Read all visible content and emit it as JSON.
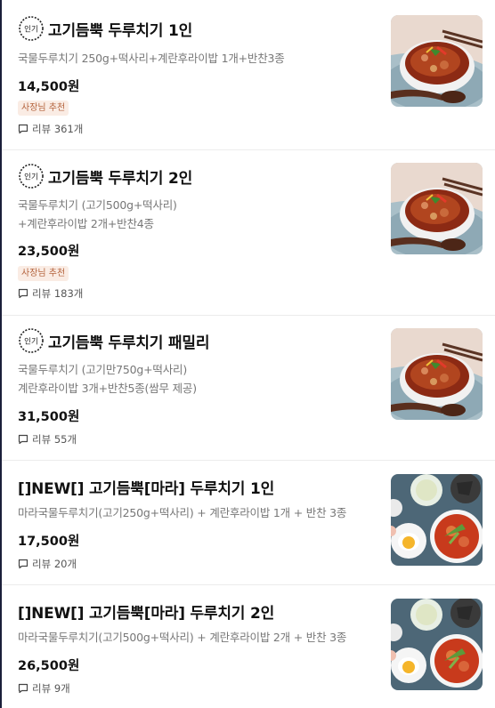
{
  "menu_items": [
    {
      "badge": "인기",
      "title": "고기듬뿍 두루치기 1인",
      "description_lines": [
        "국물두루치기 250g+떡사리+계란후라이밥 1개+반찬3종"
      ],
      "price": "14,500원",
      "tag": "사장님 추천",
      "review": "리뷰 361개",
      "image": "jeyuk-bowl-photo"
    },
    {
      "badge": "인기",
      "title": "고기듬뿍 두루치기 2인",
      "description_lines": [
        "국물두루치기 (고기500g+떡사리)",
        "+계란후라이밥 2개+반찬4종"
      ],
      "price": "23,500원",
      "tag": "사장님 추천",
      "review": "리뷰 183개",
      "image": "jeyuk-bowl-photo"
    },
    {
      "badge": "인기",
      "title": "고기듬뿍 두루치기 패밀리",
      "description_lines": [
        "국물두루치기 (고기만750g+떡사리)",
        "계란후라이밥 3개+반찬5종(쌈무 제공)"
      ],
      "price": "31,500원",
      "tag": "",
      "review": "리뷰 55개",
      "image": "jeyuk-bowl-photo"
    },
    {
      "badge": "",
      "title": "[]NEW[] 고기듬뿍[마라] 두루치기 1인",
      "description_lines": [
        "마라국물두루치기(고기250g+떡사리) + 계란후라이밥 1개 + 반찬 3종"
      ],
      "price": "17,500원",
      "tag": "",
      "review": "리뷰 20개",
      "image": "mala-set-photo"
    },
    {
      "badge": "",
      "title": "[]NEW[] 고기듬뿍[마라] 두루치기 2인",
      "description_lines": [
        "마라국물두루치기(고기500g+떡사리) + 계란후라이밥 2개 + 반찬 3종"
      ],
      "price": "26,500원",
      "tag": "",
      "review": "리뷰 9개",
      "image": "mala-set-photo"
    }
  ],
  "colors": {
    "tag_text": "#b5653f",
    "tag_bg": "#faece4",
    "frame": "#1b1f3a"
  }
}
